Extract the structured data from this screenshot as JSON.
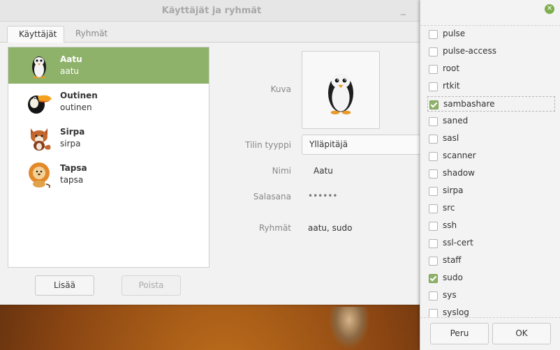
{
  "window": {
    "title": "Käyttäjät ja ryhmät",
    "minimize_glyph": "_"
  },
  "tabs": [
    {
      "label": "Käyttäjät",
      "active": true
    },
    {
      "label": "Ryhmät",
      "active": false
    }
  ],
  "users": [
    {
      "name": "Aatu",
      "login": "aatu",
      "avatar": "penguin-icon",
      "selected": true
    },
    {
      "name": "Outinen",
      "login": "outinen",
      "avatar": "toucan-icon",
      "selected": false
    },
    {
      "name": "Sirpa",
      "login": "sirpa",
      "avatar": "fox-icon",
      "selected": false
    },
    {
      "name": "Tapsa",
      "login": "tapsa",
      "avatar": "lion-icon",
      "selected": false
    }
  ],
  "buttons": {
    "add": "Lisää",
    "remove": "Poista"
  },
  "details": {
    "picture_label": "Kuva",
    "account_type_label": "Tilin tyyppi",
    "account_type_value": "Ylläpitäjä",
    "name_label": "Nimi",
    "name_value": "Aatu",
    "password_label": "Salasana",
    "password_value": "••••••",
    "groups_label": "Ryhmät",
    "groups_value": "aatu, sudo"
  },
  "group_dialog": {
    "close_glyph": "✕",
    "groups": [
      {
        "name": "pulse",
        "checked": false
      },
      {
        "name": "pulse-access",
        "checked": false
      },
      {
        "name": "root",
        "checked": false
      },
      {
        "name": "rtkit",
        "checked": false
      },
      {
        "name": "sambashare",
        "checked": true,
        "focused": true
      },
      {
        "name": "saned",
        "checked": false
      },
      {
        "name": "sasl",
        "checked": false
      },
      {
        "name": "scanner",
        "checked": false
      },
      {
        "name": "shadow",
        "checked": false
      },
      {
        "name": "sirpa",
        "checked": false
      },
      {
        "name": "src",
        "checked": false
      },
      {
        "name": "ssh",
        "checked": false
      },
      {
        "name": "ssl-cert",
        "checked": false
      },
      {
        "name": "staff",
        "checked": false
      },
      {
        "name": "sudo",
        "checked": true
      },
      {
        "name": "sys",
        "checked": false
      },
      {
        "name": "syslog",
        "checked": false
      }
    ],
    "cancel_label": "Peru",
    "ok_label": "OK"
  },
  "colors": {
    "accent": "#8fb26a",
    "window_bg": "#ededed"
  }
}
